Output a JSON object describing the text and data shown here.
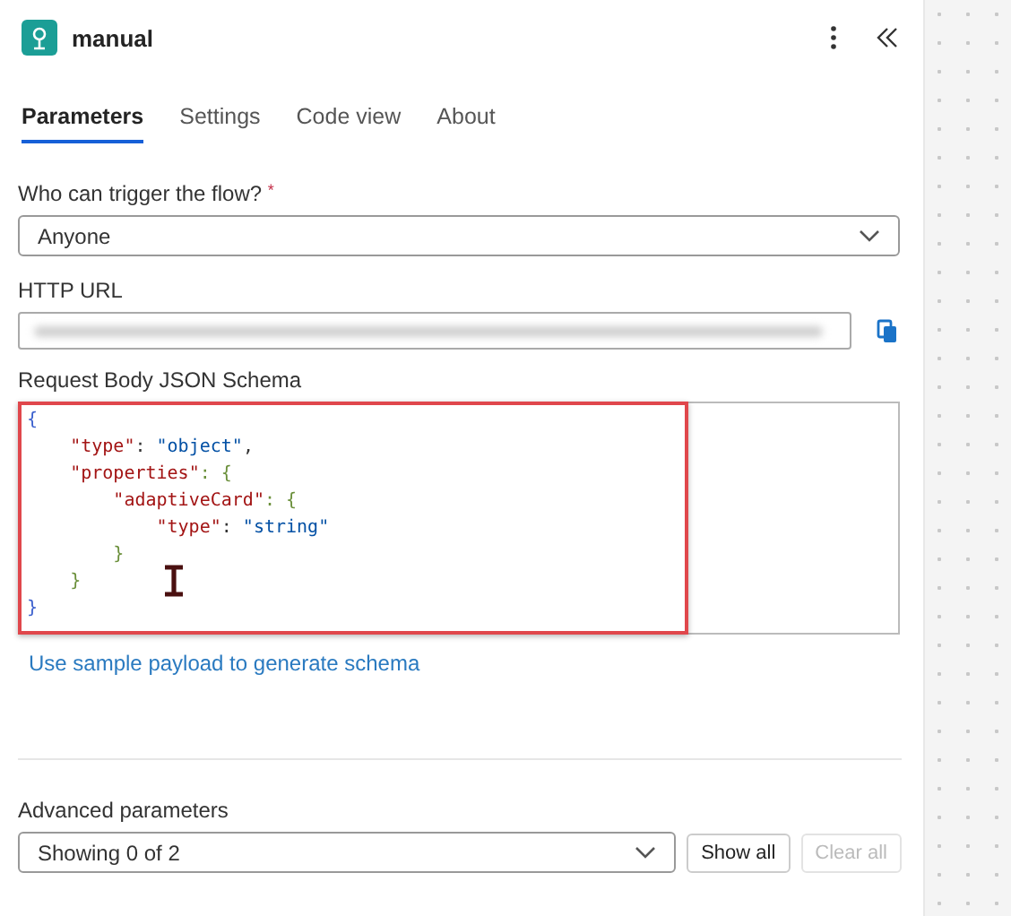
{
  "header": {
    "title": "manual"
  },
  "tabs": [
    {
      "label": "Parameters",
      "selected": true
    },
    {
      "label": "Settings",
      "selected": false
    },
    {
      "label": "Code view",
      "selected": false
    },
    {
      "label": "About",
      "selected": false
    }
  ],
  "trigger": {
    "label": "Who can trigger the flow?",
    "required_mark": "*",
    "value": "Anyone"
  },
  "http_url": {
    "label": "HTTP URL"
  },
  "schema": {
    "label": "Request Body JSON Schema",
    "highlighted": true,
    "lines": [
      "{",
      "    \"type\": \"object\",",
      "    \"properties\": {",
      "        \"adaptiveCard\": {",
      "            \"type\": \"string\"",
      "        }",
      "    }",
      "}"
    ]
  },
  "link": "Use sample payload to generate schema",
  "advanced": {
    "label": "Advanced parameters",
    "value": "Showing 0 of 2",
    "buttons": [
      {
        "label": "Show all",
        "disabled": false
      },
      {
        "label": "Clear all",
        "disabled": true
      }
    ]
  }
}
